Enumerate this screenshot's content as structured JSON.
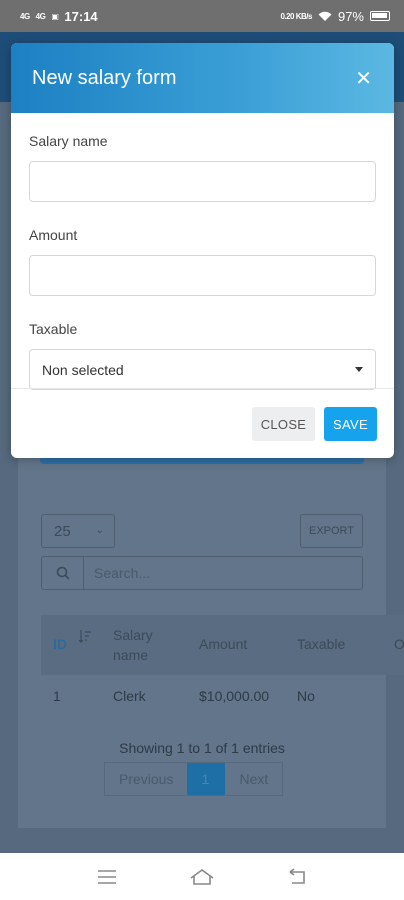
{
  "status_bar": {
    "signal1": "4G",
    "signal2": "4G",
    "time": "17:14",
    "speed": "0.20 KB/s",
    "battery": "97%"
  },
  "modal": {
    "title": "New salary form",
    "fields": {
      "salary_name_label": "Salary name",
      "salary_name_value": "",
      "amount_label": "Amount",
      "amount_value": "",
      "taxable_label": "Taxable",
      "taxable_selected": "Non selected"
    },
    "close_label": "CLOSE",
    "save_label": "SAVE"
  },
  "background": {
    "page_size": "25",
    "export_label": "EXPORT",
    "search_placeholder": "Search...",
    "table": {
      "headers": [
        "ID",
        "Salary name",
        "Amount",
        "Taxable",
        "O"
      ],
      "rows": [
        [
          "1",
          "Clerk",
          "$10,000.00",
          "No"
        ]
      ]
    },
    "info": "Showing 1 to 1 of 1 entries",
    "pagination": {
      "previous": "Previous",
      "current": "1",
      "next": "Next"
    }
  }
}
